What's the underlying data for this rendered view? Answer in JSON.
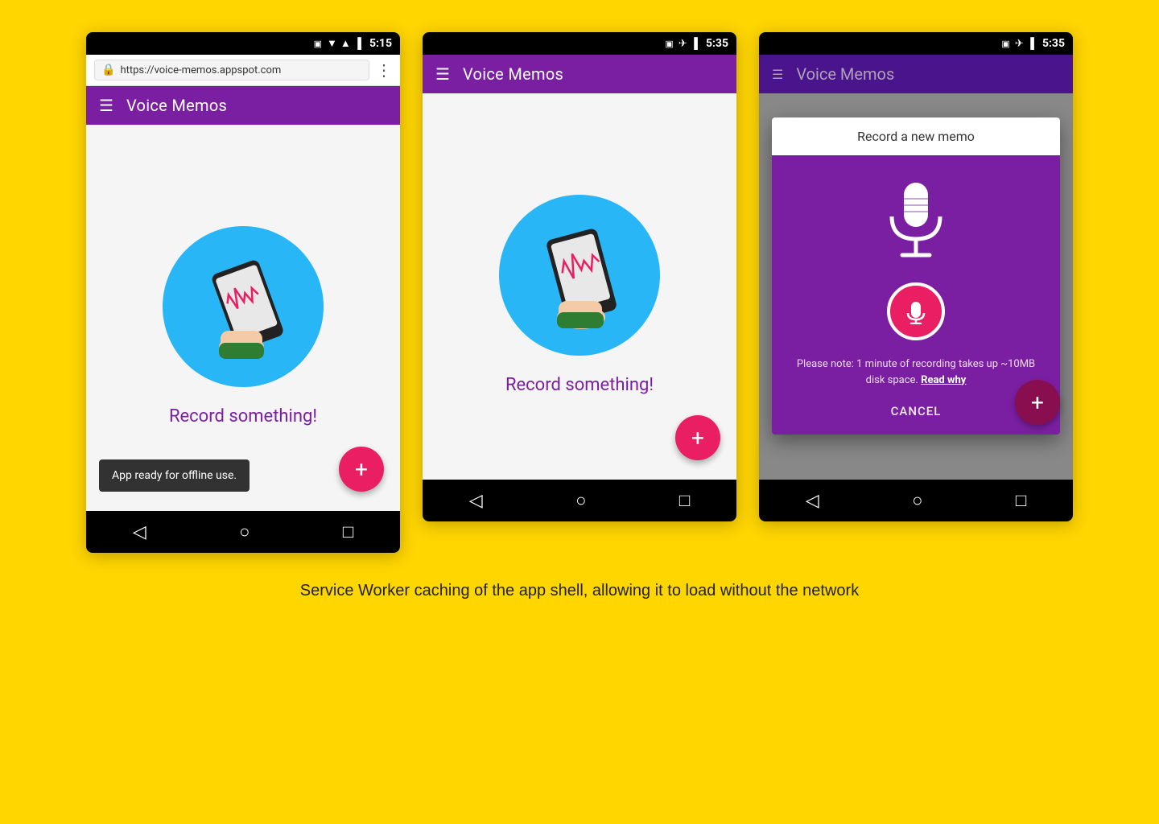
{
  "background_color": "#FFD600",
  "caption": "Service Worker caching of the app shell, allowing it to load without the network",
  "phones": [
    {
      "id": "phone1",
      "status_bar": {
        "time": "5:15",
        "icons": [
          "wifi",
          "signal",
          "battery"
        ],
        "has_sim": true
      },
      "has_browser_bar": true,
      "browser_bar": {
        "url": "https://voice-memos.appspot.com",
        "lock_symbol": "🔒"
      },
      "toolbar": {
        "title": "Voice Memos"
      },
      "content": {
        "record_label": "Record something!"
      },
      "snackbar": {
        "text": "App ready for offline use."
      },
      "fab_label": "+"
    },
    {
      "id": "phone2",
      "status_bar": {
        "time": "5:35",
        "icons": [
          "airplane",
          "battery"
        ],
        "has_sim": true
      },
      "has_browser_bar": false,
      "toolbar": {
        "title": "Voice Memos"
      },
      "content": {
        "record_label": "Record something!"
      },
      "fab_label": "+"
    },
    {
      "id": "phone3",
      "status_bar": {
        "time": "5:35",
        "icons": [
          "airplane",
          "battery"
        ],
        "has_sim": true
      },
      "has_browser_bar": false,
      "toolbar": {
        "title": "Voice Memos",
        "dimmed": true
      },
      "dialog": {
        "title": "Record a new memo",
        "note": "Please note: 1 minute of recording takes up ~10MB disk space.",
        "note_link": "Read why",
        "cancel_label": "CANCEL"
      },
      "fab_label": "+"
    }
  ],
  "nav_buttons": [
    "◁",
    "○",
    "□"
  ]
}
